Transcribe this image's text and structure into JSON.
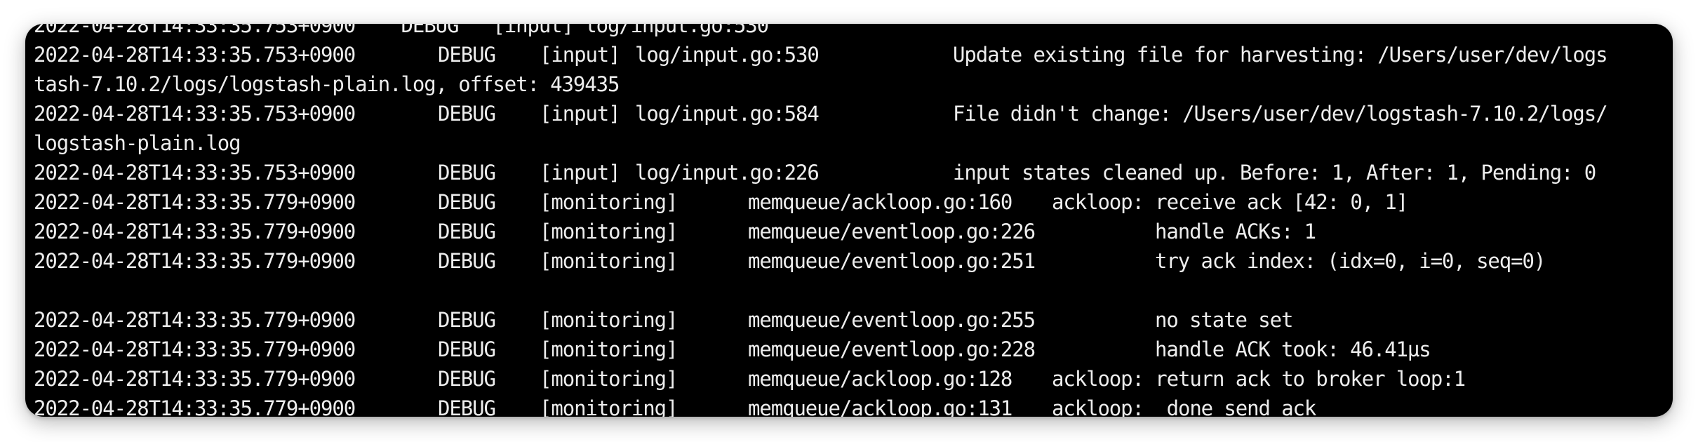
{
  "terminal": {
    "partial_top_line": "2022-04-28T14:33:35.753+0900    DEBUG   [input] log/input.go:530",
    "lines": [
      {
        "timestamp": "2022-04-28T14:33:35.753+0900",
        "level": "DEBUG",
        "module": "[input]",
        "location": "log/input.go:530",
        "message": "Update existing file for harvesting: /Users/user/dev/logs",
        "continuation": "tash-7.10.2/logs/logstash-plain.log, offset: 439435"
      },
      {
        "timestamp": "2022-04-28T14:33:35.753+0900",
        "level": "DEBUG",
        "module": "[input]",
        "location": "log/input.go:584",
        "message": "File didn't change: /Users/user/dev/logstash-7.10.2/logs/",
        "continuation": "logstash-plain.log"
      },
      {
        "timestamp": "2022-04-28T14:33:35.753+0900",
        "level": "DEBUG",
        "module": "[input]",
        "location": "log/input.go:226",
        "message": "input states cleaned up. Before: 1, After: 1, Pending: 0"
      },
      {
        "timestamp": "2022-04-28T14:33:35.779+0900",
        "level": "DEBUG",
        "module": "[monitoring]",
        "location": "memqueue/ackloop.go:160",
        "message": "ackloop: receive ack [42: 0, 1]"
      },
      {
        "timestamp": "2022-04-28T14:33:35.779+0900",
        "level": "DEBUG",
        "module": "[monitoring]",
        "location": "memqueue/eventloop.go:226",
        "message": "handle ACKs: 1"
      },
      {
        "timestamp": "2022-04-28T14:33:35.779+0900",
        "level": "DEBUG",
        "module": "[monitoring]",
        "location": "memqueue/eventloop.go:251",
        "message": "try ack index: (idx=0, i=0, seq=0)"
      },
      {
        "timestamp": "2022-04-28T14:33:35.779+0900",
        "level": "DEBUG",
        "module": "[monitoring]",
        "location": "memqueue/eventloop.go:255",
        "message": "no state set"
      },
      {
        "timestamp": "2022-04-28T14:33:35.779+0900",
        "level": "DEBUG",
        "module": "[monitoring]",
        "location": "memqueue/eventloop.go:228",
        "message": "handle ACK took: 46.41µs"
      },
      {
        "timestamp": "2022-04-28T14:33:35.779+0900",
        "level": "DEBUG",
        "module": "[monitoring]",
        "location": "memqueue/ackloop.go:128",
        "message": "ackloop: return ack to broker loop:1"
      },
      {
        "timestamp": "2022-04-28T14:33:35.779+0900",
        "level": "DEBUG",
        "module": "[monitoring]",
        "location": "memqueue/ackloop.go:131",
        "message": "ackloop:  done send ack"
      }
    ]
  },
  "colors": {
    "background": "#000000",
    "text": "#ededed",
    "page": "#ffffff"
  }
}
